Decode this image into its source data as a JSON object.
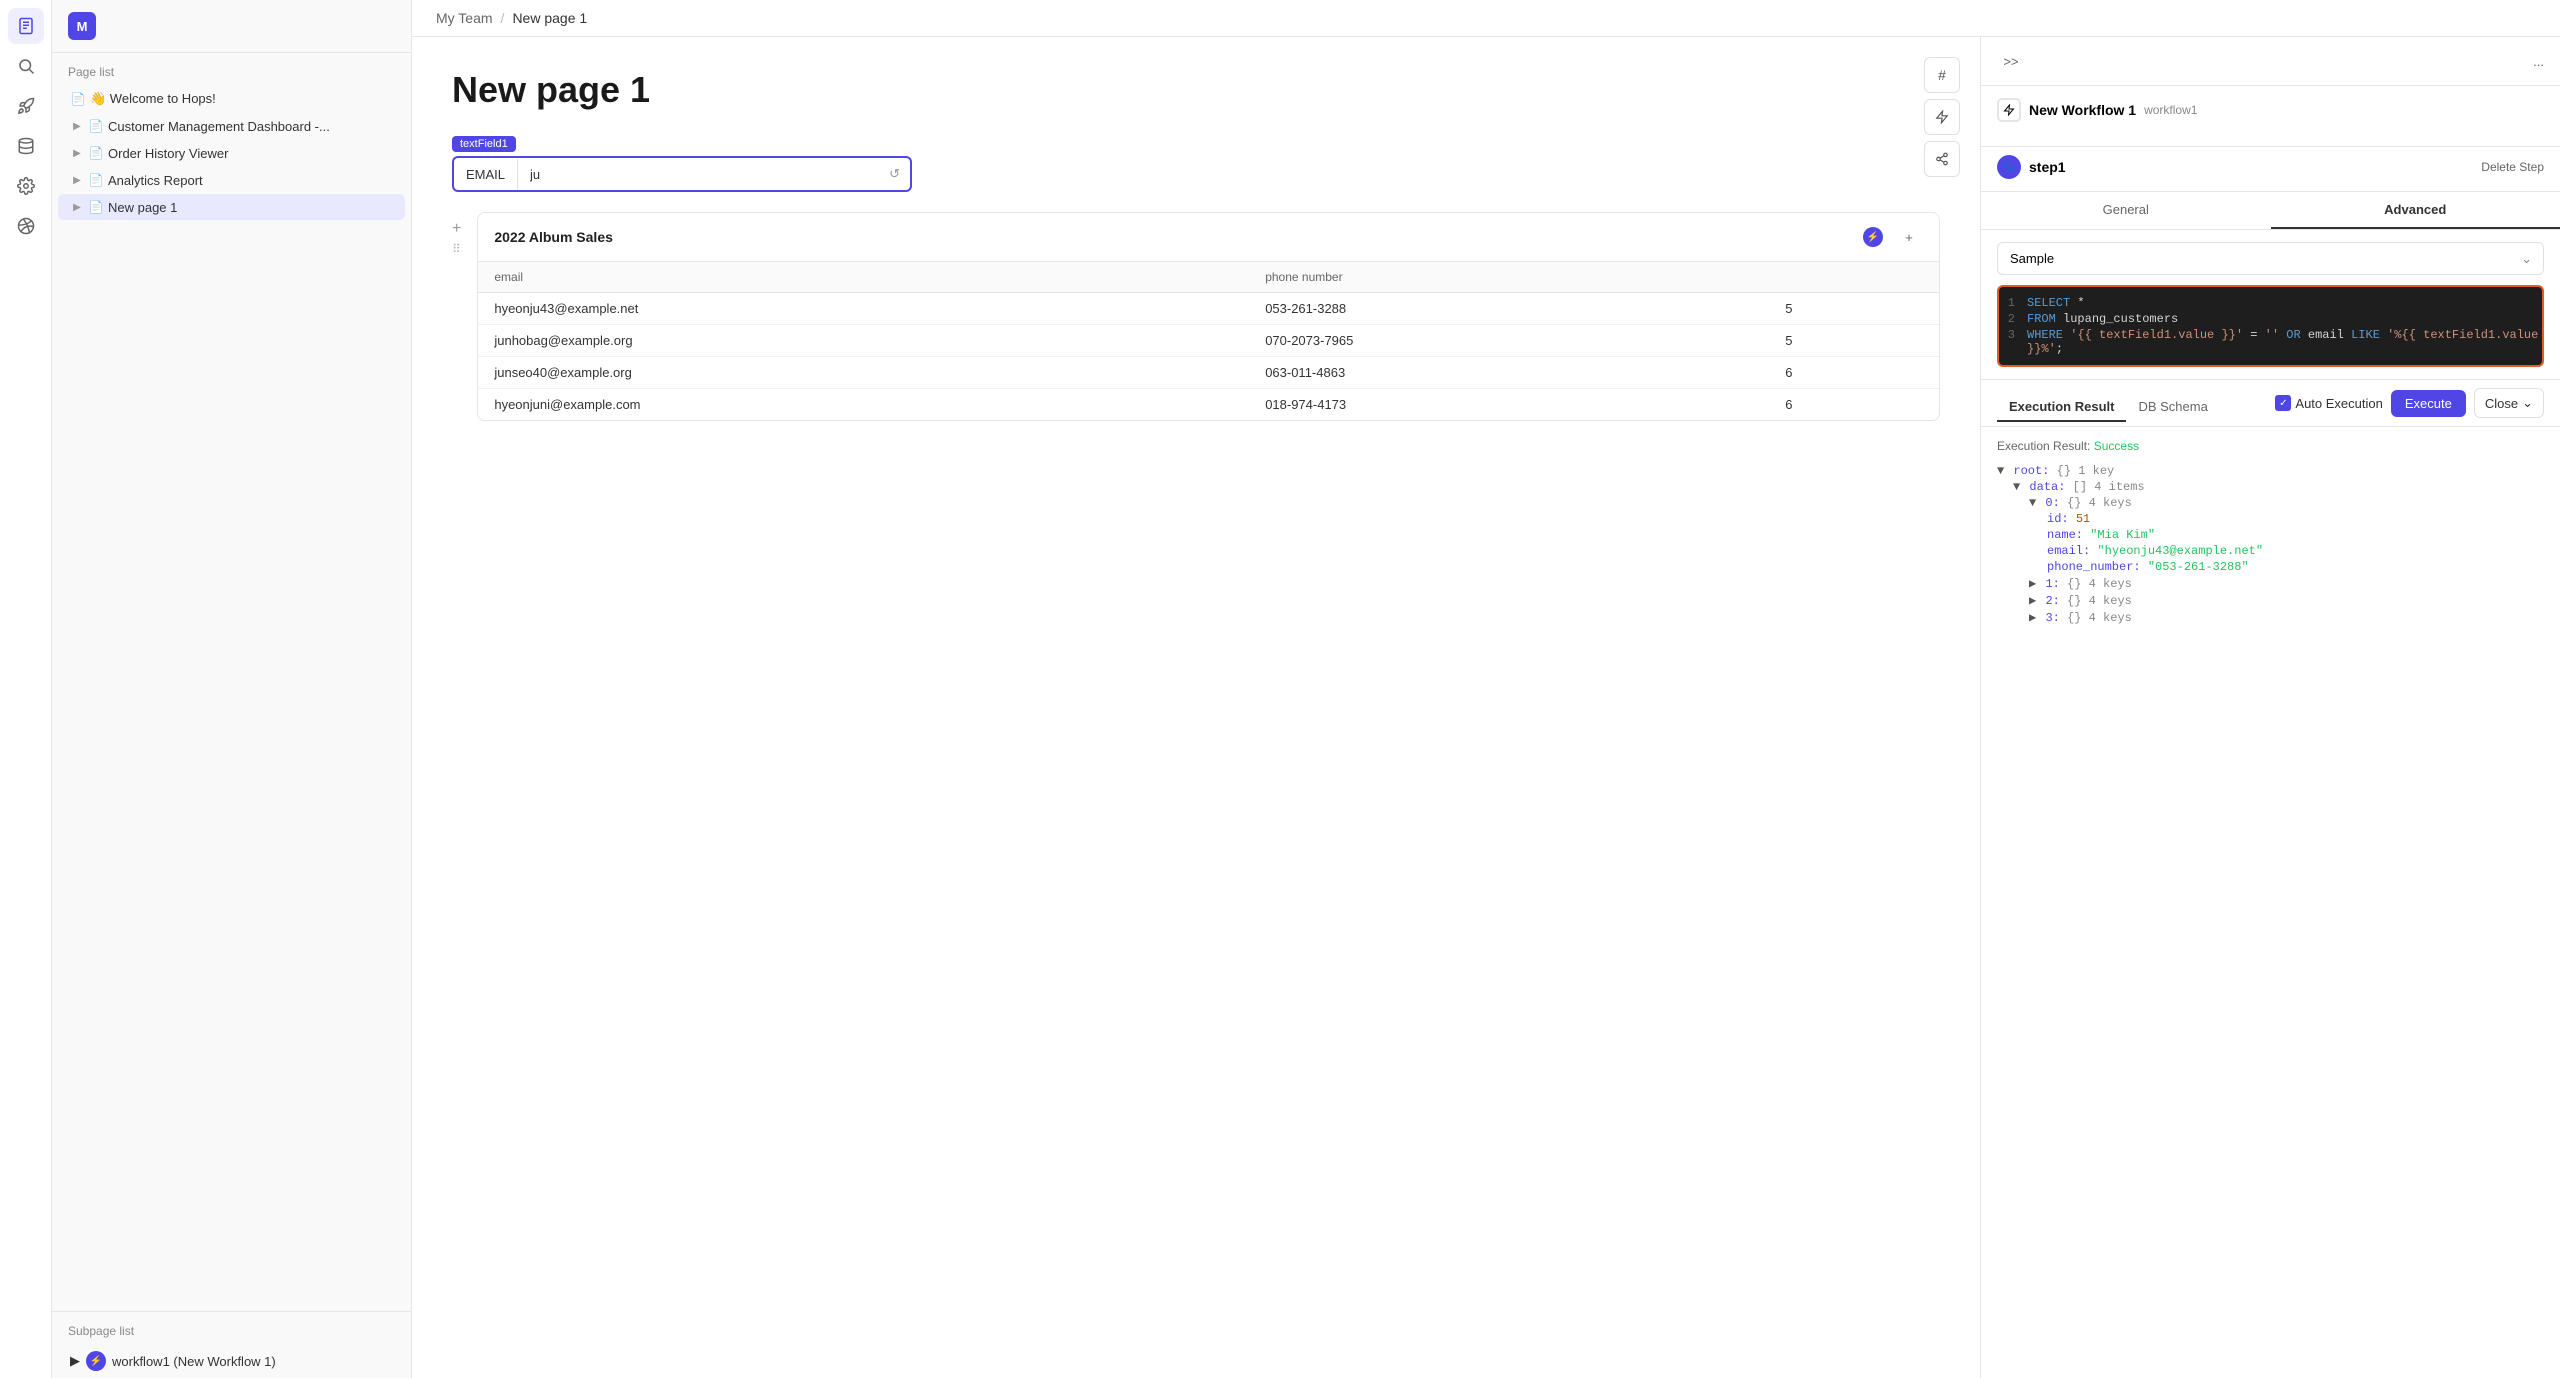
{
  "app": {
    "avatar_label": "M"
  },
  "sidebar": {
    "page_list_label": "Page list",
    "items": [
      {
        "id": "welcome",
        "label": "👋 Welcome to Hops!",
        "emoji": "👋",
        "indent": 0,
        "has_chevron": false
      },
      {
        "id": "customer-mgmt",
        "label": "Customer Management Dashboard -...",
        "indent": 1,
        "has_chevron": true
      },
      {
        "id": "order-history",
        "label": "Order History Viewer",
        "indent": 1,
        "has_chevron": true
      },
      {
        "id": "analytics",
        "label": "Analytics Report",
        "indent": 1,
        "has_chevron": true
      },
      {
        "id": "new-page",
        "label": "New page 1",
        "indent": 1,
        "has_chevron": true,
        "active": true
      }
    ],
    "subpage_list_label": "Subpage list",
    "subpage_items": [
      {
        "id": "workflow1",
        "label": "workflow1 (New Workflow 1)"
      }
    ]
  },
  "breadcrumb": {
    "team": "My Team",
    "separator": "/",
    "page": "New page 1"
  },
  "page": {
    "title": "New page 1"
  },
  "textfield": {
    "badge_label": "textField1",
    "prefix_label": "EMAIL",
    "value": "ju"
  },
  "table": {
    "title": "2022 Album Sales",
    "columns": [
      "email",
      "phone number"
    ],
    "rows": [
      {
        "email": "hyeonju43@example.net",
        "phone": "053-261-3288",
        "extra": "5"
      },
      {
        "email": "junhobag@example.org",
        "phone": "070-2073-7965",
        "extra": "5"
      },
      {
        "email": "junseo40@example.org",
        "phone": "063-011-4863",
        "extra": "6"
      },
      {
        "email": "hyeonjuni@example.com",
        "phone": "018-974-4173",
        "extra": "6"
      }
    ]
  },
  "workflow_panel": {
    "collapse_label": ">>",
    "menu_label": "...",
    "workflow_name": "New Workflow 1",
    "workflow_id": "workflow1",
    "step_name": "step1",
    "delete_step_label": "Delete Step",
    "tabs": [
      "General",
      "Advanced"
    ],
    "active_tab": "Advanced",
    "datasource_label": "Sample",
    "code_lines": [
      {
        "num": 1,
        "content": "SELECT *"
      },
      {
        "num": 2,
        "content": "FROM lupang_customers"
      },
      {
        "num": 3,
        "content": "WHERE '{{ textField1.value }}' = '' OR email LIKE '%{{ textField1.value }}%';"
      }
    ],
    "exec_tabs": [
      "Execution Result",
      "DB Schema"
    ],
    "active_exec_tab": "Execution Result",
    "auto_exec_label": "Auto Execution",
    "execute_btn_label": "Execute",
    "close_btn_label": "Close",
    "result_label": "Execution Result:",
    "result_status": "Success",
    "json_tree": {
      "root_label": "root:",
      "root_meta": "{} 1 key",
      "data_label": "data:",
      "data_meta": "[] 4 items",
      "item0_label": "0:",
      "item0_meta": "{} 4 keys",
      "id_label": "id:",
      "id_val": "51",
      "name_label": "name:",
      "name_val": "\"Mia Kim\"",
      "email_label": "email:",
      "email_val": "\"hyeonju43@example.net\"",
      "phone_label": "phone_number:",
      "phone_val": "\"053-261-3288\"",
      "item1_label": "1:",
      "item1_meta": "{} 4 keys",
      "item2_label": "2:",
      "item2_meta": "{} 4 keys",
      "item3_label": "3:",
      "item3_meta": "{} 4 keys"
    }
  }
}
